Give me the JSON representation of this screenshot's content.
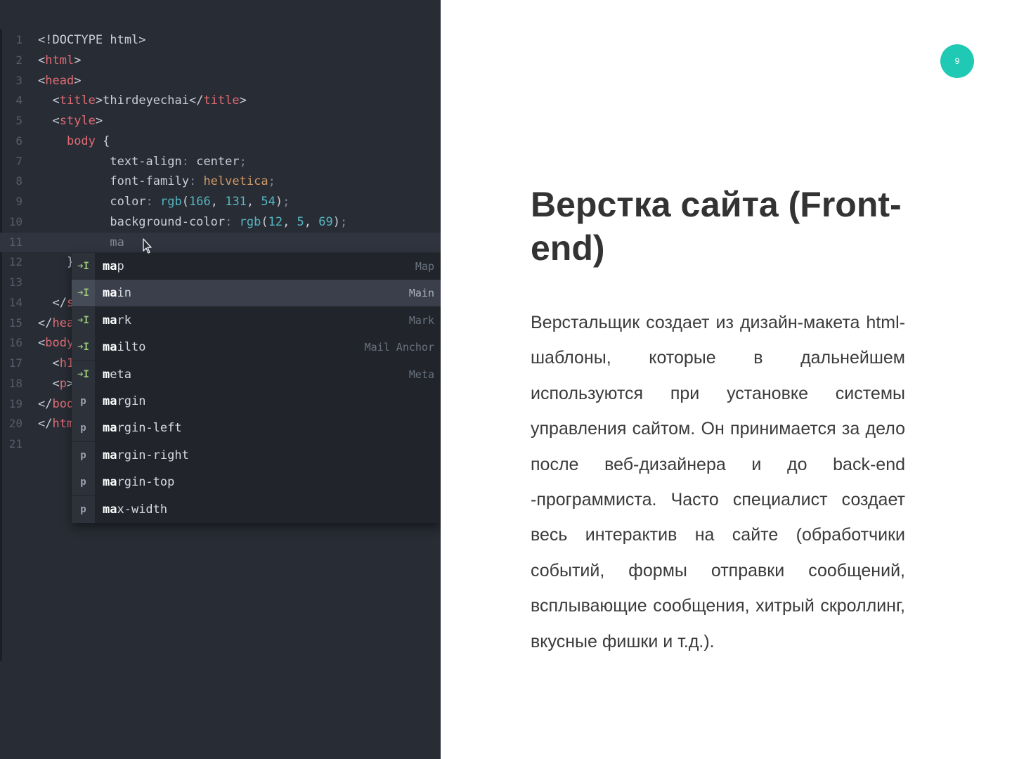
{
  "editor": {
    "lines": [
      {
        "n": "1",
        "indent": "",
        "tokens": [
          [
            "t-prop",
            "<!DOCTYPE html>"
          ]
        ]
      },
      {
        "n": "2",
        "indent": "",
        "tokens": [
          [
            "t-prop",
            "<"
          ],
          [
            "t-tag",
            "html"
          ],
          [
            "t-prop",
            ">"
          ]
        ]
      },
      {
        "n": "3",
        "indent": "",
        "tokens": [
          [
            "t-prop",
            "<"
          ],
          [
            "t-tag",
            "head"
          ],
          [
            "t-prop",
            ">"
          ]
        ]
      },
      {
        "n": "4",
        "indent": "  ",
        "tokens": [
          [
            "t-prop",
            "<"
          ],
          [
            "t-tag",
            "title"
          ],
          [
            "t-prop",
            ">thirdeyechai</"
          ],
          [
            "t-tag",
            "title"
          ],
          [
            "t-prop",
            ">"
          ]
        ]
      },
      {
        "n": "5",
        "indent": "  ",
        "tokens": [
          [
            "t-prop",
            "<"
          ],
          [
            "t-tag",
            "style"
          ],
          [
            "t-prop",
            ">"
          ]
        ]
      },
      {
        "n": "6",
        "indent": "    ",
        "tokens": [
          [
            "t-tag",
            "body"
          ],
          [
            "t-prop",
            " {"
          ]
        ]
      },
      {
        "n": "7",
        "indent": "          ",
        "tokens": [
          [
            "t-prop",
            "text-align"
          ],
          [
            "t-dim",
            ": "
          ],
          [
            "t-prop",
            "center"
          ],
          [
            "t-dim",
            ";"
          ]
        ]
      },
      {
        "n": "8",
        "indent": "          ",
        "tokens": [
          [
            "t-prop",
            "font-family"
          ],
          [
            "t-dim",
            ": "
          ],
          [
            "t-str",
            "helvetica"
          ],
          [
            "t-dim",
            ";"
          ]
        ]
      },
      {
        "n": "9",
        "indent": "          ",
        "tokens": [
          [
            "t-prop",
            "color"
          ],
          [
            "t-dim",
            ": "
          ],
          [
            "t-fn",
            "rgb"
          ],
          [
            "t-prop",
            "("
          ],
          [
            "t-num",
            "166"
          ],
          [
            "t-prop",
            ", "
          ],
          [
            "t-num",
            "131"
          ],
          [
            "t-prop",
            ", "
          ],
          [
            "t-num",
            "54"
          ],
          [
            "t-prop",
            ")"
          ],
          [
            "t-dim",
            ";"
          ]
        ]
      },
      {
        "n": "10",
        "indent": "          ",
        "tokens": [
          [
            "t-prop",
            "background-color"
          ],
          [
            "t-dim",
            ": "
          ],
          [
            "t-fn",
            "rgb"
          ],
          [
            "t-prop",
            "("
          ],
          [
            "t-num",
            "12"
          ],
          [
            "t-prop",
            ", "
          ],
          [
            "t-num",
            "5"
          ],
          [
            "t-prop",
            ", "
          ],
          [
            "t-num",
            "69"
          ],
          [
            "t-prop",
            ")"
          ],
          [
            "t-dim",
            ";"
          ]
        ]
      },
      {
        "n": "11",
        "indent": "          ",
        "tokens": [
          [
            "t-dim",
            "ma"
          ]
        ],
        "cursor": true
      },
      {
        "n": "12",
        "indent": "    ",
        "tokens": [
          [
            "t-prop",
            "}"
          ]
        ]
      },
      {
        "n": "13",
        "indent": "",
        "tokens": []
      },
      {
        "n": "14",
        "indent": "  ",
        "tokens": [
          [
            "t-prop",
            "</"
          ],
          [
            "t-tag",
            "s"
          ]
        ]
      },
      {
        "n": "15",
        "indent": "",
        "tokens": [
          [
            "t-prop",
            "</"
          ],
          [
            "t-tag",
            "hea"
          ]
        ]
      },
      {
        "n": "16",
        "indent": "",
        "tokens": [
          [
            "t-prop",
            "<"
          ],
          [
            "t-tag",
            "body"
          ],
          [
            "t-prop",
            ">"
          ]
        ]
      },
      {
        "n": "17",
        "indent": "  ",
        "tokens": [
          [
            "t-prop",
            "<"
          ],
          [
            "t-tag",
            "h1"
          ],
          [
            "t-prop",
            ">"
          ]
        ]
      },
      {
        "n": "18",
        "indent": "  ",
        "tokens": [
          [
            "t-prop",
            "<"
          ],
          [
            "t-tag",
            "p"
          ],
          [
            "t-prop",
            ">"
          ]
        ]
      },
      {
        "n": "19",
        "indent": "",
        "tokens": [
          [
            "t-prop",
            "</"
          ],
          [
            "t-tag",
            "body"
          ]
        ]
      },
      {
        "n": "20",
        "indent": "",
        "tokens": [
          [
            "t-prop",
            "</"
          ],
          [
            "t-tag",
            "htm"
          ]
        ]
      },
      {
        "n": "21",
        "indent": "",
        "tokens": []
      }
    ],
    "autocomplete": {
      "items": [
        {
          "icon": "snippet-icon",
          "glyph": "➜I",
          "match": "ma",
          "rest": "p",
          "right": "Map",
          "selected": false
        },
        {
          "icon": "snippet-icon",
          "glyph": "➜I",
          "match": "ma",
          "rest": "in",
          "right": "Main",
          "selected": true
        },
        {
          "icon": "snippet-icon",
          "glyph": "➜I",
          "match": "ma",
          "rest": "rk",
          "right": "Mark",
          "selected": false
        },
        {
          "icon": "snippet-icon",
          "glyph": "➜I",
          "match": "ma",
          "rest": "ilto",
          "right": "Mail Anchor",
          "selected": false
        },
        {
          "icon": "snippet-icon",
          "glyph": "➜I",
          "match": "m",
          "rest": "eta",
          "right": "Meta",
          "selected": false
        },
        {
          "icon": "property-icon",
          "glyph": "p",
          "match": "ma",
          "rest": "rgin",
          "right": "",
          "selected": false
        },
        {
          "icon": "property-icon",
          "glyph": "p",
          "match": "ma",
          "rest": "rgin-left",
          "right": "",
          "selected": false
        },
        {
          "icon": "property-icon",
          "glyph": "p",
          "match": "ma",
          "rest": "rgin-right",
          "right": "",
          "selected": false
        },
        {
          "icon": "property-icon",
          "glyph": "p",
          "match": "ma",
          "rest": "rgin-top",
          "right": "",
          "selected": false
        },
        {
          "icon": "property-icon",
          "glyph": "p",
          "match": "ma",
          "rest": "x-width",
          "right": "",
          "selected": false
        }
      ]
    }
  },
  "slide": {
    "page_number": "9",
    "title": "Верстка сайта (Front-end)",
    "body": "Верстальщик создает из дизайн-макета html-шаблоны, которые в дальнейшем используются при установке системы управления сайтом. Он принимается за дело после веб-дизайнера и до back-end -программиста. Часто специалист создает весь интерактив на сайте (обработчики событий, формы отправки сообщений, всплывающие сообщения, хитрый скроллинг, вкусные фишки и т.д.).",
    "accent_color": "#1fc9b3"
  }
}
